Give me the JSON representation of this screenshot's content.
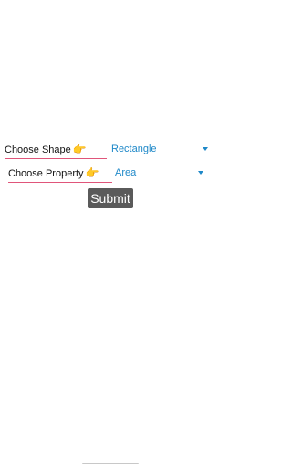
{
  "form": {
    "shape_label": "Choose Shape",
    "shape_value": "Rectangle",
    "property_label": "Choose Property",
    "property_value": "Area",
    "submit_label": "Submit",
    "pointer_glyph": "👉"
  },
  "colors": {
    "accent": "#1e88c8",
    "underline": "#e0557a",
    "button_bg": "#5a5a5a"
  }
}
